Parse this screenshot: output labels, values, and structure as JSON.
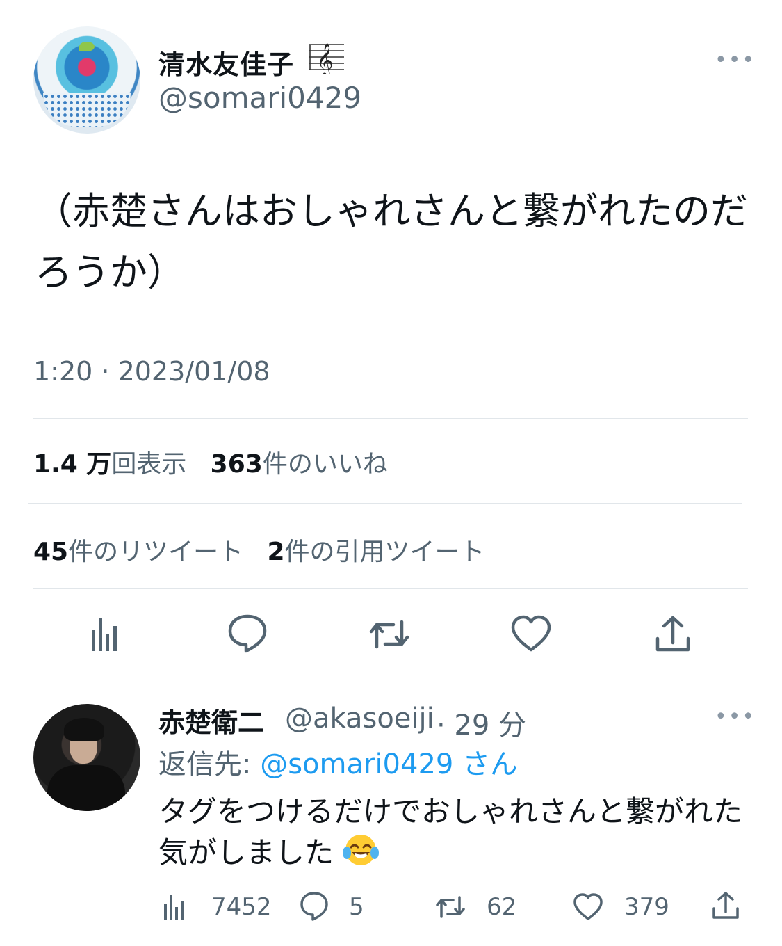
{
  "tweet": {
    "display_name": "清水友佳子",
    "handle": "@somari0429",
    "text": "（赤楚さんはおしゃれさんと繋がれたのだろうか）",
    "timestamp": "1:20 · 2023/01/08",
    "views_count": "1.4 万",
    "views_label": "回表示",
    "likes_count": "363",
    "likes_label": "件のいいね",
    "retweets_count": "45",
    "retweets_label": "件のリツイート",
    "quotes_count": "2",
    "quotes_label": "件の引用ツイート",
    "more_label": "•••"
  },
  "reply": {
    "display_name": "赤楚衛二",
    "handle": "@akasoeiji",
    "time": "· 29 分",
    "reply_prefix": "返信先: ",
    "reply_to": "@somari0429 さん",
    "text": "タグをつけるだけでおしゃれさんと繋がれた気がしました",
    "views": "7452",
    "replies": "5",
    "retweets": "62",
    "likes": "379",
    "more_label": "•••"
  },
  "icons": {
    "views": "analytics-icon",
    "reply": "reply-bubble-icon",
    "retweet": "retweet-icon",
    "like": "heart-icon",
    "share": "share-upload-icon",
    "emoji": "face-with-tears-of-joy"
  },
  "colors": {
    "text": "#0f1419",
    "secondary": "#536471",
    "link": "#1d9bf0",
    "divider": "#e1e6ea"
  }
}
